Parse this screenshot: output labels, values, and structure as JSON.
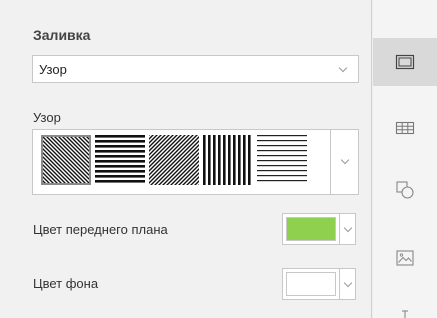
{
  "fill": {
    "title": "Заливка",
    "type_value": "Узор"
  },
  "pattern": {
    "label": "Узор",
    "swatches": [
      {
        "icon": "diagonal-down-dense-pattern-icon",
        "selected": true
      },
      {
        "icon": "horizontal-dense-pattern-icon",
        "selected": false
      },
      {
        "icon": "diagonal-up-dense-pattern-icon",
        "selected": false
      },
      {
        "icon": "vertical-dense-pattern-icon",
        "selected": false
      },
      {
        "icon": "horizontal-light-pattern-icon",
        "selected": false
      }
    ]
  },
  "foreground": {
    "label": "Цвет переднего плана",
    "color": "#8fd14f"
  },
  "background": {
    "label": "Цвет фона",
    "color": "#ffffff"
  },
  "toolbar": {
    "items": [
      {
        "icon": "slide-settings-icon",
        "active": true
      },
      {
        "icon": "table-settings-icon",
        "active": false
      },
      {
        "icon": "shape-settings-icon",
        "active": false
      },
      {
        "icon": "image-settings-icon",
        "active": false
      },
      {
        "icon": "text-settings-icon",
        "active": false
      }
    ]
  }
}
